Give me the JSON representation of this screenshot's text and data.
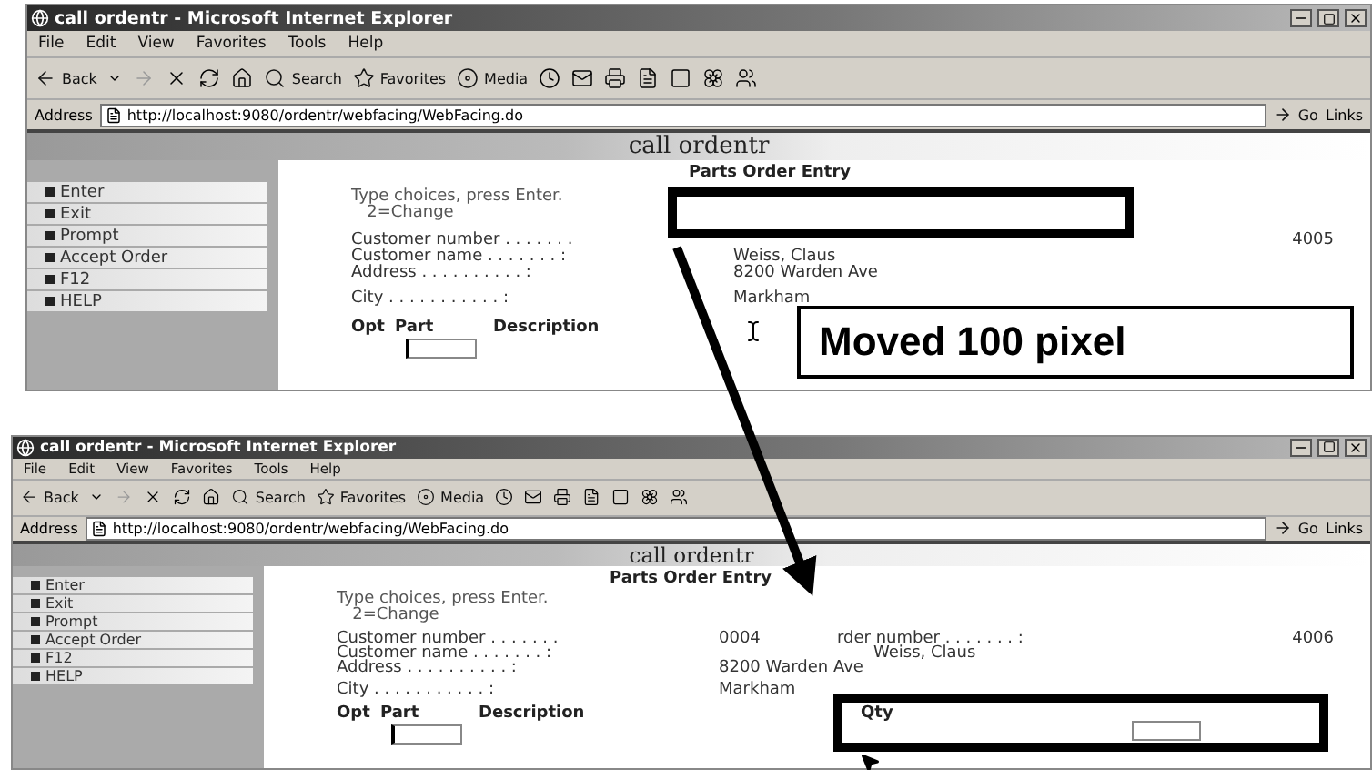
{
  "screenshots": [
    {
      "title": "call ordentr - Microsoft Internet Explorer",
      "menu": [
        "File",
        "Edit",
        "View",
        "Favorites",
        "Tools",
        "Help"
      ],
      "toolbar": [
        "Back",
        "Search",
        "Favorites",
        "Media"
      ],
      "address_label": "Address",
      "url": "http://localhost:9080/ordentr/webfacing/WebFacing.do",
      "go": "Go",
      "links": "Links",
      "page_title": "call ordentr",
      "heading": "Parts Order Entry",
      "commands": [
        "Enter",
        "Exit",
        "Prompt",
        "Accept Order",
        "F12",
        "HELP"
      ],
      "instructions": [
        "Type choices, press Enter.",
        "2=Change"
      ],
      "rows": [
        {
          "label": "Customer number . . . . . . .",
          "order_value": "4005"
        },
        {
          "label": "Customer name . . . . . . . :",
          "value": "Weiss, Claus"
        },
        {
          "label": "Address . . . . . . . . . . :",
          "value": "8200 Warden Ave"
        },
        {
          "label": "City  . . . . . . . . . . . :",
          "value": "Markham"
        }
      ],
      "columns": [
        "Opt",
        "Part",
        "Description"
      ]
    },
    {
      "title": "call ordentr - Microsoft Internet Explorer",
      "menu": [
        "File",
        "Edit",
        "View",
        "Favorites",
        "Tools",
        "Help"
      ],
      "toolbar": [
        "Back",
        "Search",
        "Favorites",
        "Media"
      ],
      "address_label": "Address",
      "url": "http://localhost:9080/ordentr/webfacing/WebFacing.do",
      "go": "Go",
      "links": "Links",
      "page_title": "call ordentr",
      "heading": "Parts Order Entry",
      "commands": [
        "Enter",
        "Exit",
        "Prompt",
        "Accept Order",
        "F12",
        "HELP"
      ],
      "instructions": [
        "Type choices, press Enter.",
        "2=Change"
      ],
      "rows": [
        {
          "label": "Customer number . . . . . . .",
          "value": "0004",
          "order_label": "rder number . . . . . . . :",
          "order_value": "4006"
        },
        {
          "label": "Customer name . . . . . . . :",
          "shifted_value": "Weiss, Claus"
        },
        {
          "label": "Address . . . . . . . . . . :",
          "value": "8200 Warden Ave"
        },
        {
          "label": "City  . . . . . . . . . . . :",
          "value": "Markham"
        }
      ],
      "columns": [
        "Opt",
        "Part",
        "Description"
      ],
      "qty": "Qty"
    }
  ],
  "callout": "Moved 100 pixel"
}
